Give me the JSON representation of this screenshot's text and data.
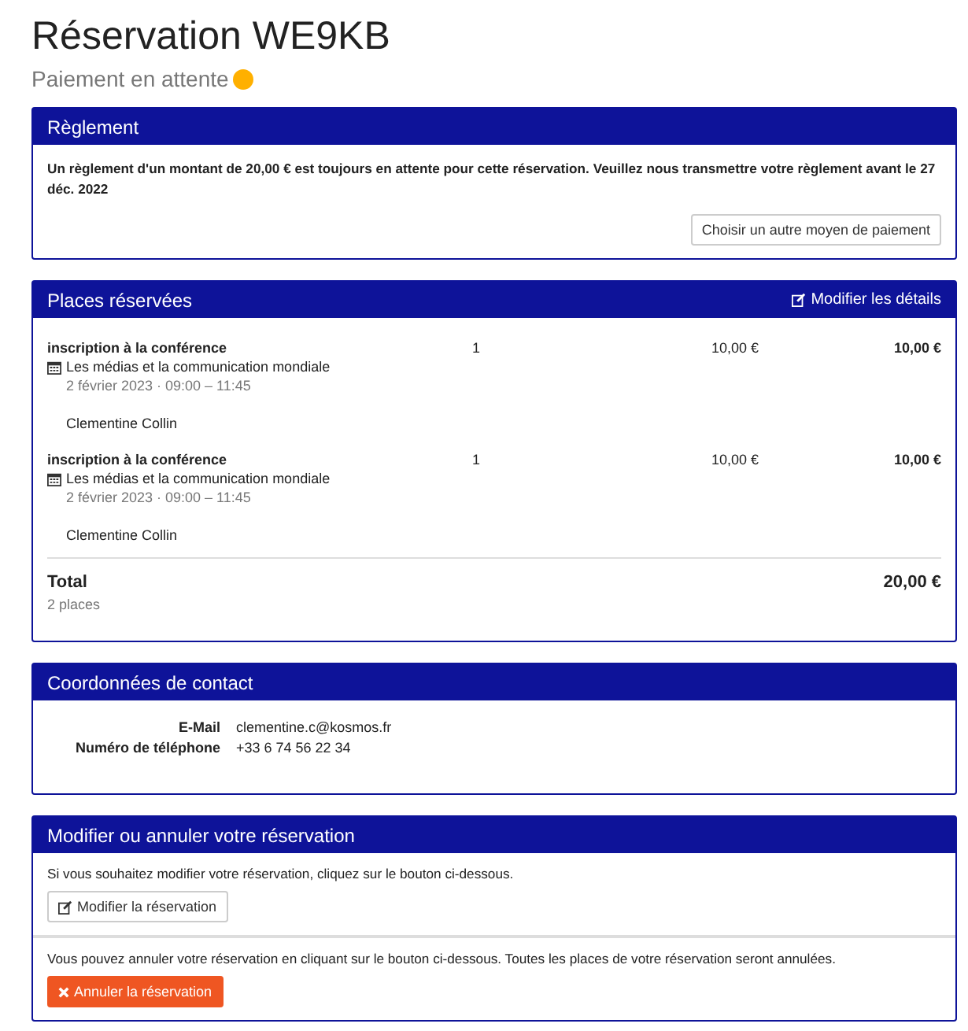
{
  "title": "Réservation WE9KB",
  "status": "Paiement en attente",
  "payment": {
    "heading": "Règlement",
    "message": "Un règlement d'un montant de 20,00 € est toujours en attente pour cette réservation. Veuillez nous transmettre votre règlement avant le 27 déc. 2022",
    "button": "Choisir un autre moyen de paiement"
  },
  "positions": {
    "heading": "Places réservées",
    "edit_link": "Modifier les détails",
    "items": [
      {
        "product": "inscription à la conférence",
        "event": "Les médias et la communication mondiale",
        "date": "2 février 2023 · 09:00 – 11:45",
        "attendee": "Clementine Collin",
        "quantity": "1",
        "price": "10,00 €",
        "total": "10,00 €"
      },
      {
        "product": "inscription à la conférence",
        "event": "Les médias et la communication mondiale",
        "date": "2 février 2023 · 09:00 – 11:45",
        "attendee": "Clementine Collin",
        "quantity": "1",
        "price": "10,00 €",
        "total": "10,00 €"
      }
    ],
    "total_label": "Total",
    "total_count": "2 places",
    "total": "20,00 €"
  },
  "contact": {
    "heading": "Coordonnées de contact",
    "fields": [
      {
        "label": "E-Mail",
        "value": "clementine.c@kosmos.fr"
      },
      {
        "label": "Numéro de téléphone",
        "value": "+33 6 74 56 22 34"
      }
    ]
  },
  "change": {
    "heading": "Modifier ou annuler votre réservation",
    "modify_text": "Si vous souhaitez modifier votre réservation, cliquez sur le bouton ci-dessous.",
    "modify_button": "Modifier la réservation",
    "cancel_text": "Vous pouvez annuler votre réservation en cliquant sur le bouton ci-dessous. Toutes les places de votre réservation seront annulées.",
    "cancel_button": "Annuler la réservation"
  }
}
